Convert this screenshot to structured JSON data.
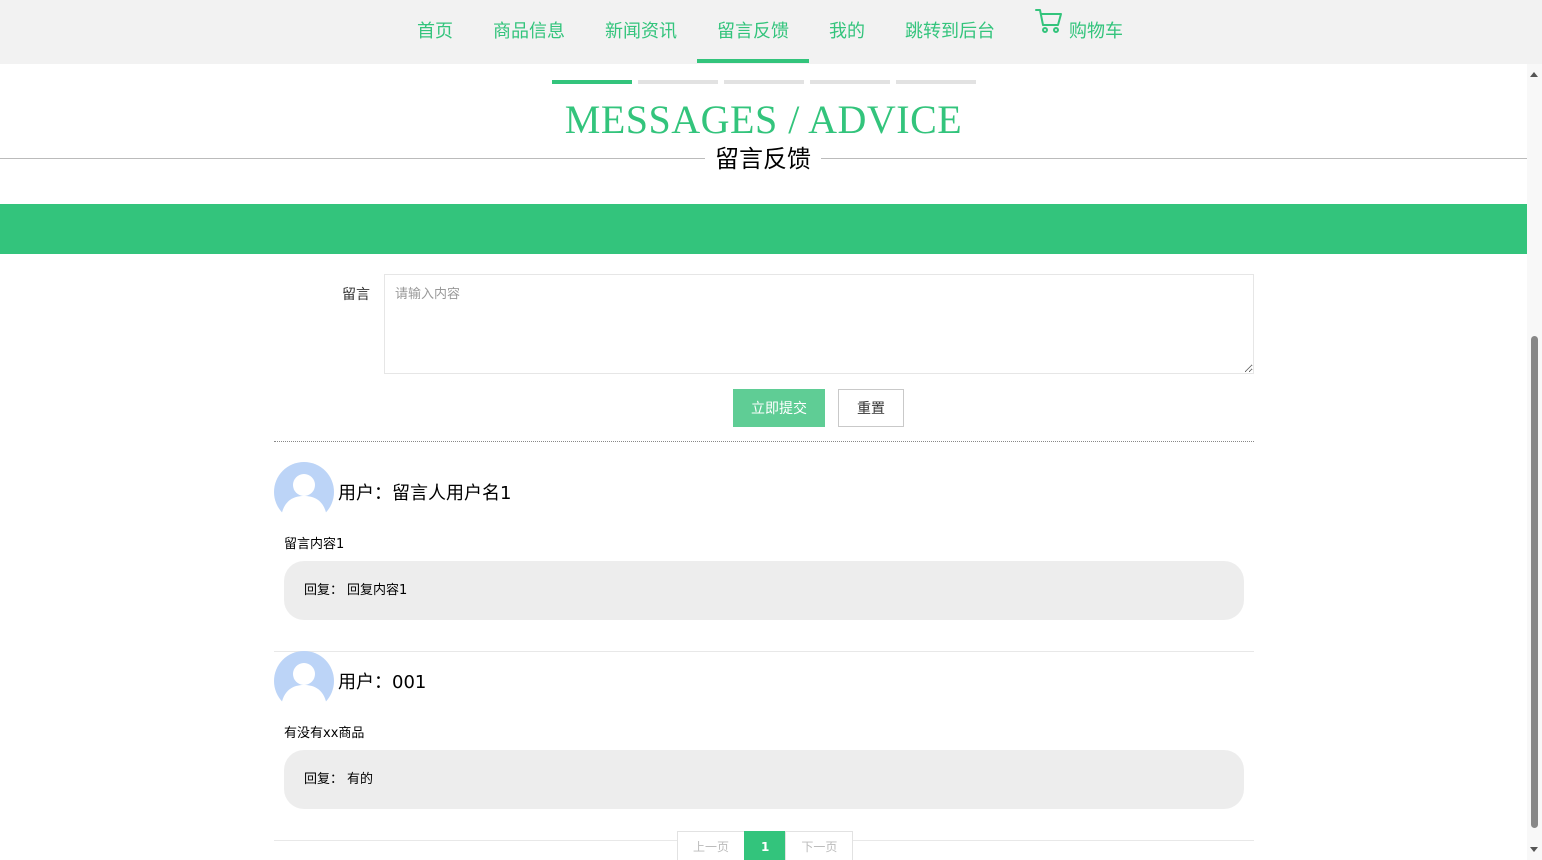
{
  "nav": {
    "items": [
      {
        "label": "首页"
      },
      {
        "label": "商品信息"
      },
      {
        "label": "新闻资讯"
      },
      {
        "label": "留言反馈"
      },
      {
        "label": "我的"
      },
      {
        "label": "跳转到后台"
      },
      {
        "label": "购物车",
        "icon": "cart-icon"
      }
    ],
    "active_index": 3
  },
  "header": {
    "title_en": "MESSAGES / ADVICE",
    "title_cn": "留言反馈"
  },
  "form": {
    "label": "留言",
    "placeholder": "请输入内容",
    "value": "",
    "submit_label": "立即提交",
    "reset_label": "重置"
  },
  "messages": [
    {
      "user_prefix": "用户：",
      "user": "留言人用户名1",
      "content": "留言内容1",
      "reply_prefix": "回复：",
      "reply": "回复内容1"
    },
    {
      "user_prefix": "用户：",
      "user": "001",
      "content": "有没有xx商品",
      "reply_prefix": "回复：",
      "reply": "有的"
    }
  ],
  "pager": {
    "prev": "上一页",
    "current": "1",
    "next": "下一页"
  },
  "colors": {
    "accent": "#33c47c",
    "nav_bg": "#f2f2f2",
    "reply_bg": "#ededed",
    "avatar": "#bcd4f7"
  }
}
